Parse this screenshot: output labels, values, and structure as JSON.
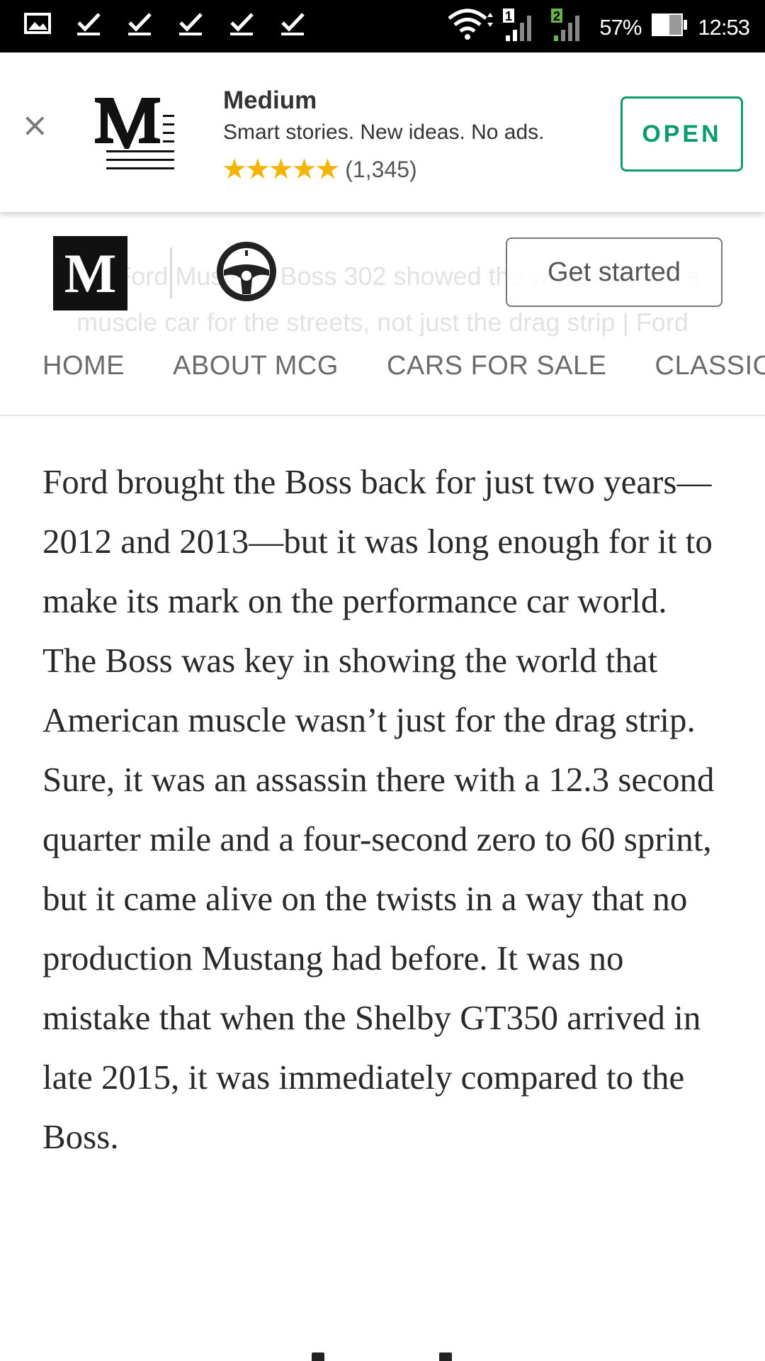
{
  "status_bar": {
    "notification_icons": [
      "gallery-icon",
      "check-icon",
      "check-icon",
      "check-icon",
      "check-icon",
      "check-icon"
    ],
    "sim1_label": "1",
    "sim2_label": "2",
    "battery_text": "57%",
    "clock": "12:53"
  },
  "app_banner": {
    "close_label": "×",
    "app_name": "Medium",
    "tagline": "Smart stories. New ideas. No ads.",
    "stars": "★★★★★",
    "rating_count": "(1,345)",
    "open_label": "OPEN",
    "accent_color": "#0a9b6f",
    "star_color": "#f5b400"
  },
  "site_header": {
    "medium_mark": "M",
    "get_started_label": "Get started",
    "ghost_caption": "The Ford Mustang Boss 302 showed the world that it's a muscle car for the streets, not just the drag strip | Ford",
    "nav": [
      "HOME",
      "ABOUT MCG",
      "CARS FOR SALE",
      "CLASSIC"
    ]
  },
  "article": {
    "paragraph": "Ford brought the Boss back for just two years—2012 and 2013—but it was long enough for it to make its mark on the performance car world. The Boss was key in showing the world that American muscle wasn’t just for the drag strip. Sure, it was an assassin there with a 12.3 second quarter mile and a four-second zero to 60 sprint, but it came alive on the twists in a way that no production Mustang had before. It was no mistake that when the Shelby GT350 arrived in late 2015, it was immediately compared to the Boss."
  }
}
